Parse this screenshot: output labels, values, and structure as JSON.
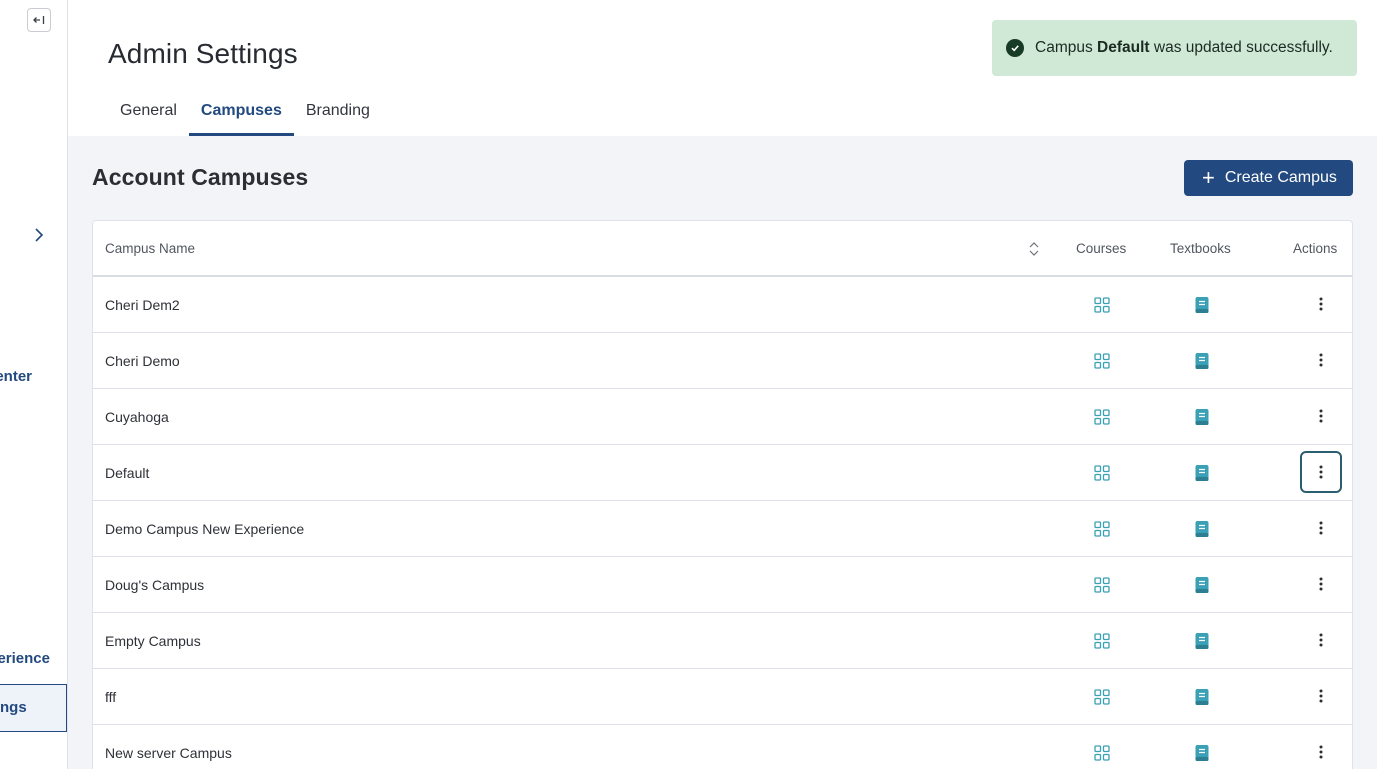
{
  "sidebar": {
    "items": [
      {
        "label": "enter"
      },
      {
        "label": "erience"
      },
      {
        "label": "ngs"
      }
    ]
  },
  "header": {
    "title": "Admin Settings",
    "tabs": [
      {
        "label": "General"
      },
      {
        "label": "Campuses"
      },
      {
        "label": "Branding"
      }
    ],
    "active_tab": "Campuses"
  },
  "toast": {
    "prefix": "Campus",
    "campus": "Default",
    "suffix": "was updated successfully."
  },
  "main": {
    "section_title": "Account Campuses",
    "create_button": "Create Campus",
    "table": {
      "columns": {
        "name": "Campus Name",
        "courses": "Courses",
        "textbooks": "Textbooks",
        "actions": "Actions"
      },
      "rows": [
        {
          "name": "Cheri Dem2"
        },
        {
          "name": "Cheri Demo"
        },
        {
          "name": "Cuyahoga"
        },
        {
          "name": "Default"
        },
        {
          "name": "Demo Campus New Experience"
        },
        {
          "name": "Doug's Campus"
        },
        {
          "name": "Empty Campus"
        },
        {
          "name": "fff"
        },
        {
          "name": "New server Campus"
        }
      ],
      "focused_row": "Default"
    }
  },
  "colors": {
    "brand": "#234a80",
    "icon_teal": "#3aa0b5",
    "toast_bg": "#cfe9d6"
  }
}
